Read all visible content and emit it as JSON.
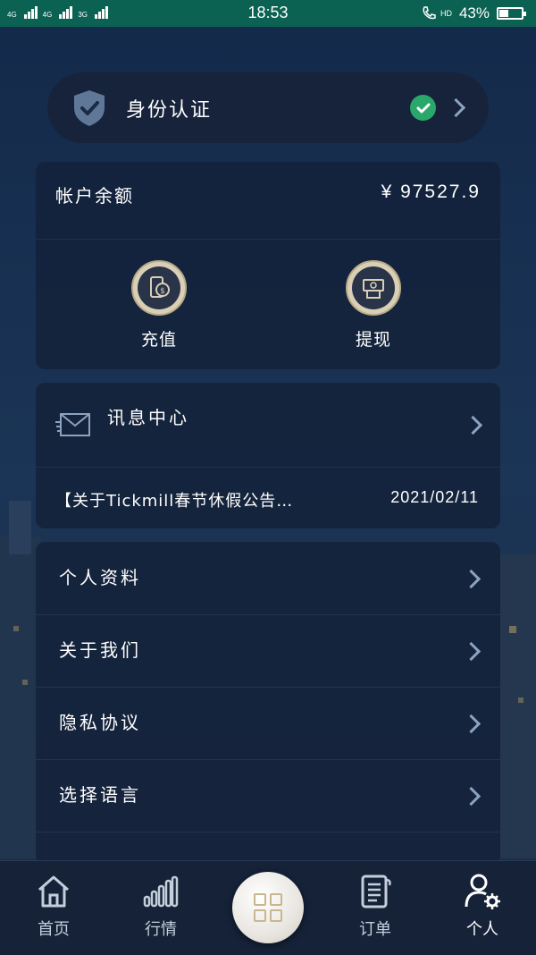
{
  "status_bar": {
    "net_left": "4G",
    "net_mid": "4G",
    "net_right": "3G",
    "time": "18:53",
    "hd": "HD",
    "battery": "43%",
    "battery_level": 0.43
  },
  "identity": {
    "label": "身份认证",
    "verified": true,
    "icon": "shield-check-icon"
  },
  "account": {
    "balance_label": "帐户余额",
    "balance_value": "¥ 97527.9",
    "actions": [
      {
        "label": "充值",
        "icon": "deposit-coin-phone-icon"
      },
      {
        "label": "提现",
        "icon": "withdraw-cash-icon"
      }
    ]
  },
  "messages": {
    "title": "讯息中心",
    "icon": "envelope-icon",
    "latest_notice": "【关于Tickmill春节休假公告…",
    "latest_date": "2021/02/11"
  },
  "menu": {
    "items": [
      {
        "label": "个人资料"
      },
      {
        "label": "关于我们"
      },
      {
        "label": "隐私协议"
      },
      {
        "label": "选择语言"
      }
    ]
  },
  "tabbar": {
    "tabs": [
      {
        "label": "首页",
        "icon": "home-icon"
      },
      {
        "label": "行情",
        "icon": "market-chart-icon"
      },
      {
        "label": "",
        "icon": "grid-menu-icon"
      },
      {
        "label": "订单",
        "icon": "order-document-icon"
      },
      {
        "label": "个人",
        "icon": "user-settings-icon"
      }
    ],
    "active": "个人"
  },
  "colors": {
    "status_bar": "#0b6152",
    "card_bg": "#15233c",
    "verified_green": "#2aa76a",
    "gold_accent": "#c9b68d"
  }
}
